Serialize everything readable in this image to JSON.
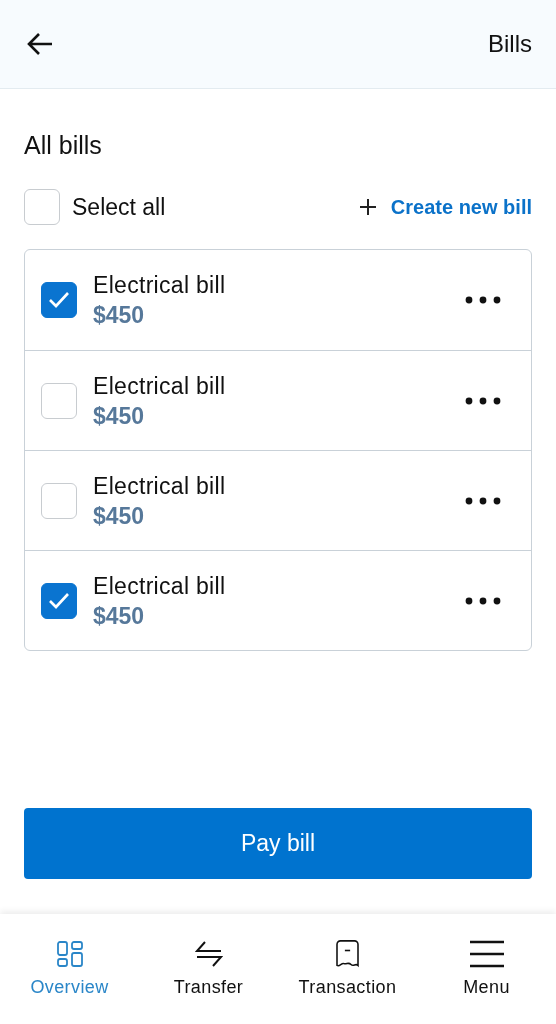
{
  "header": {
    "title": "Bills"
  },
  "section_title": "All bills",
  "select_all": {
    "label": "Select all",
    "checked": false
  },
  "create_link": {
    "label": "Create new bill"
  },
  "bills": [
    {
      "name": "Electrical bill",
      "amount": "$450",
      "checked": true
    },
    {
      "name": "Electrical bill",
      "amount": "$450",
      "checked": false
    },
    {
      "name": "Electrical bill",
      "amount": "$450",
      "checked": false
    },
    {
      "name": "Electrical bill",
      "amount": "$450",
      "checked": true
    }
  ],
  "pay_button": "Pay bill",
  "tabs": [
    {
      "label": "Overview",
      "kind": "overview",
      "selected": true
    },
    {
      "label": "Transfer",
      "kind": "transfer",
      "selected": false
    },
    {
      "label": "Transaction",
      "kind": "transaction",
      "selected": false
    },
    {
      "label": "Menu",
      "kind": "menu",
      "selected": false
    }
  ]
}
